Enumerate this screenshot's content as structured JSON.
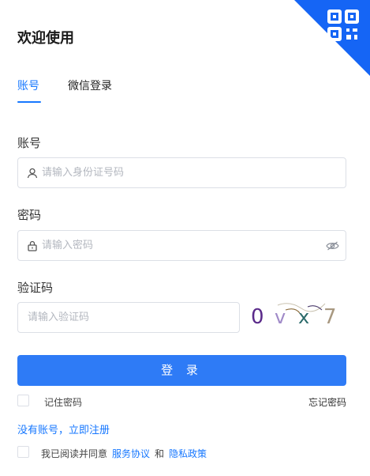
{
  "title": "欢迎使用",
  "tabs": [
    {
      "label": "账号",
      "active": true
    },
    {
      "label": "微信登录",
      "active": false
    }
  ],
  "account": {
    "label": "账号",
    "placeholder": "请输入身份证号码",
    "value": ""
  },
  "password": {
    "label": "密码",
    "placeholder": "请输入密码",
    "value": ""
  },
  "captcha": {
    "label": "验证码",
    "placeholder": "请输入验证码",
    "value": "",
    "image_chars": [
      "0",
      "v",
      "x",
      "7"
    ]
  },
  "login_button": "登 录",
  "remember_label": "记住密码",
  "forgot_label": "忘记密码",
  "register_link": "没有账号，立即注册",
  "agreement": {
    "prefix": "我已阅读并同意",
    "service_link": "服务协议",
    "and": "和",
    "privacy_link": "隐私政策"
  },
  "colors": {
    "accent": "#1677ff",
    "button": "#2e7bf6",
    "qr_corner": "#1565f5"
  },
  "icons": {
    "qr_corner": "qr-code-icon",
    "account_prefix": "user-icon",
    "password_prefix": "lock-icon",
    "password_suffix": "eye-hidden-icon"
  }
}
